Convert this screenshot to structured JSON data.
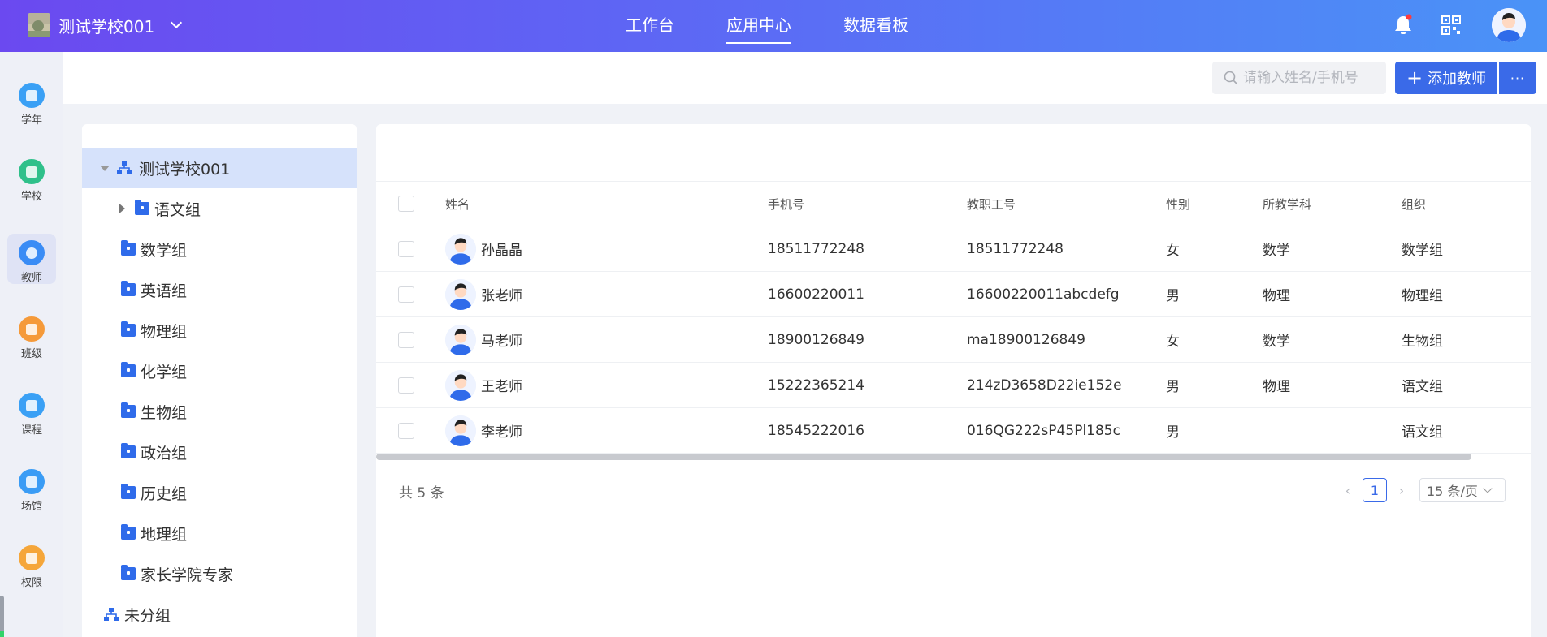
{
  "header": {
    "school_name": "测试学校001",
    "nav": [
      "工作台",
      "应用中心",
      "数据看板"
    ],
    "active_nav": "应用中心"
  },
  "sidebar": {
    "items": [
      {
        "label": "学年",
        "icon": "calendar-icon",
        "color": "#3aa0f5"
      },
      {
        "label": "学校",
        "icon": "school-icon",
        "color": "#2fc08a"
      },
      {
        "label": "教师",
        "icon": "teacher-icon",
        "color": "#3a8cf5"
      },
      {
        "label": "班级",
        "icon": "class-icon",
        "color": "#f59a3a"
      },
      {
        "label": "课程",
        "icon": "course-icon",
        "color": "#3aa0f5"
      },
      {
        "label": "场馆",
        "icon": "venue-icon",
        "color": "#3a9cf5"
      },
      {
        "label": "权限",
        "icon": "permission-icon",
        "color": "#f5a63a"
      }
    ],
    "active": "教师"
  },
  "toolbar": {
    "search_placeholder": "请输入姓名/手机号",
    "add_label": "添加教师",
    "more_label": "···"
  },
  "tree": {
    "root": "测试学校001",
    "groups": [
      "语文组",
      "数学组",
      "英语组",
      "物理组",
      "化学组",
      "生物组",
      "政治组",
      "历史组",
      "地理组",
      "家长学院专家"
    ],
    "ungrouped": "未分组"
  },
  "table": {
    "columns": [
      "姓名",
      "手机号",
      "教职工号",
      "性别",
      "所教学科",
      "组织"
    ],
    "rows": [
      {
        "name": "孙晶晶",
        "phone": "18511772248",
        "staff_id": "18511772248",
        "gender": "女",
        "subject": "数学",
        "org": "数学组"
      },
      {
        "name": "张老师",
        "phone": "16600220011",
        "staff_id": "16600220011abcdefg",
        "gender": "男",
        "subject": "物理",
        "org": "物理组"
      },
      {
        "name": "马老师",
        "phone": "18900126849",
        "staff_id": "ma18900126849",
        "gender": "女",
        "subject": "数学",
        "org": "生物组"
      },
      {
        "name": "王老师",
        "phone": "15222365214",
        "staff_id": "214zD3658D22ie152e",
        "gender": "男",
        "subject": "物理",
        "org": "语文组"
      },
      {
        "name": "李老师",
        "phone": "18545222016",
        "staff_id": "016QG222sP45Pl185c",
        "gender": "男",
        "subject": "",
        "org": "语文组"
      }
    ]
  },
  "pagination": {
    "total_text": "共 5 条",
    "current_page": "1",
    "page_size": "15 条/页"
  }
}
